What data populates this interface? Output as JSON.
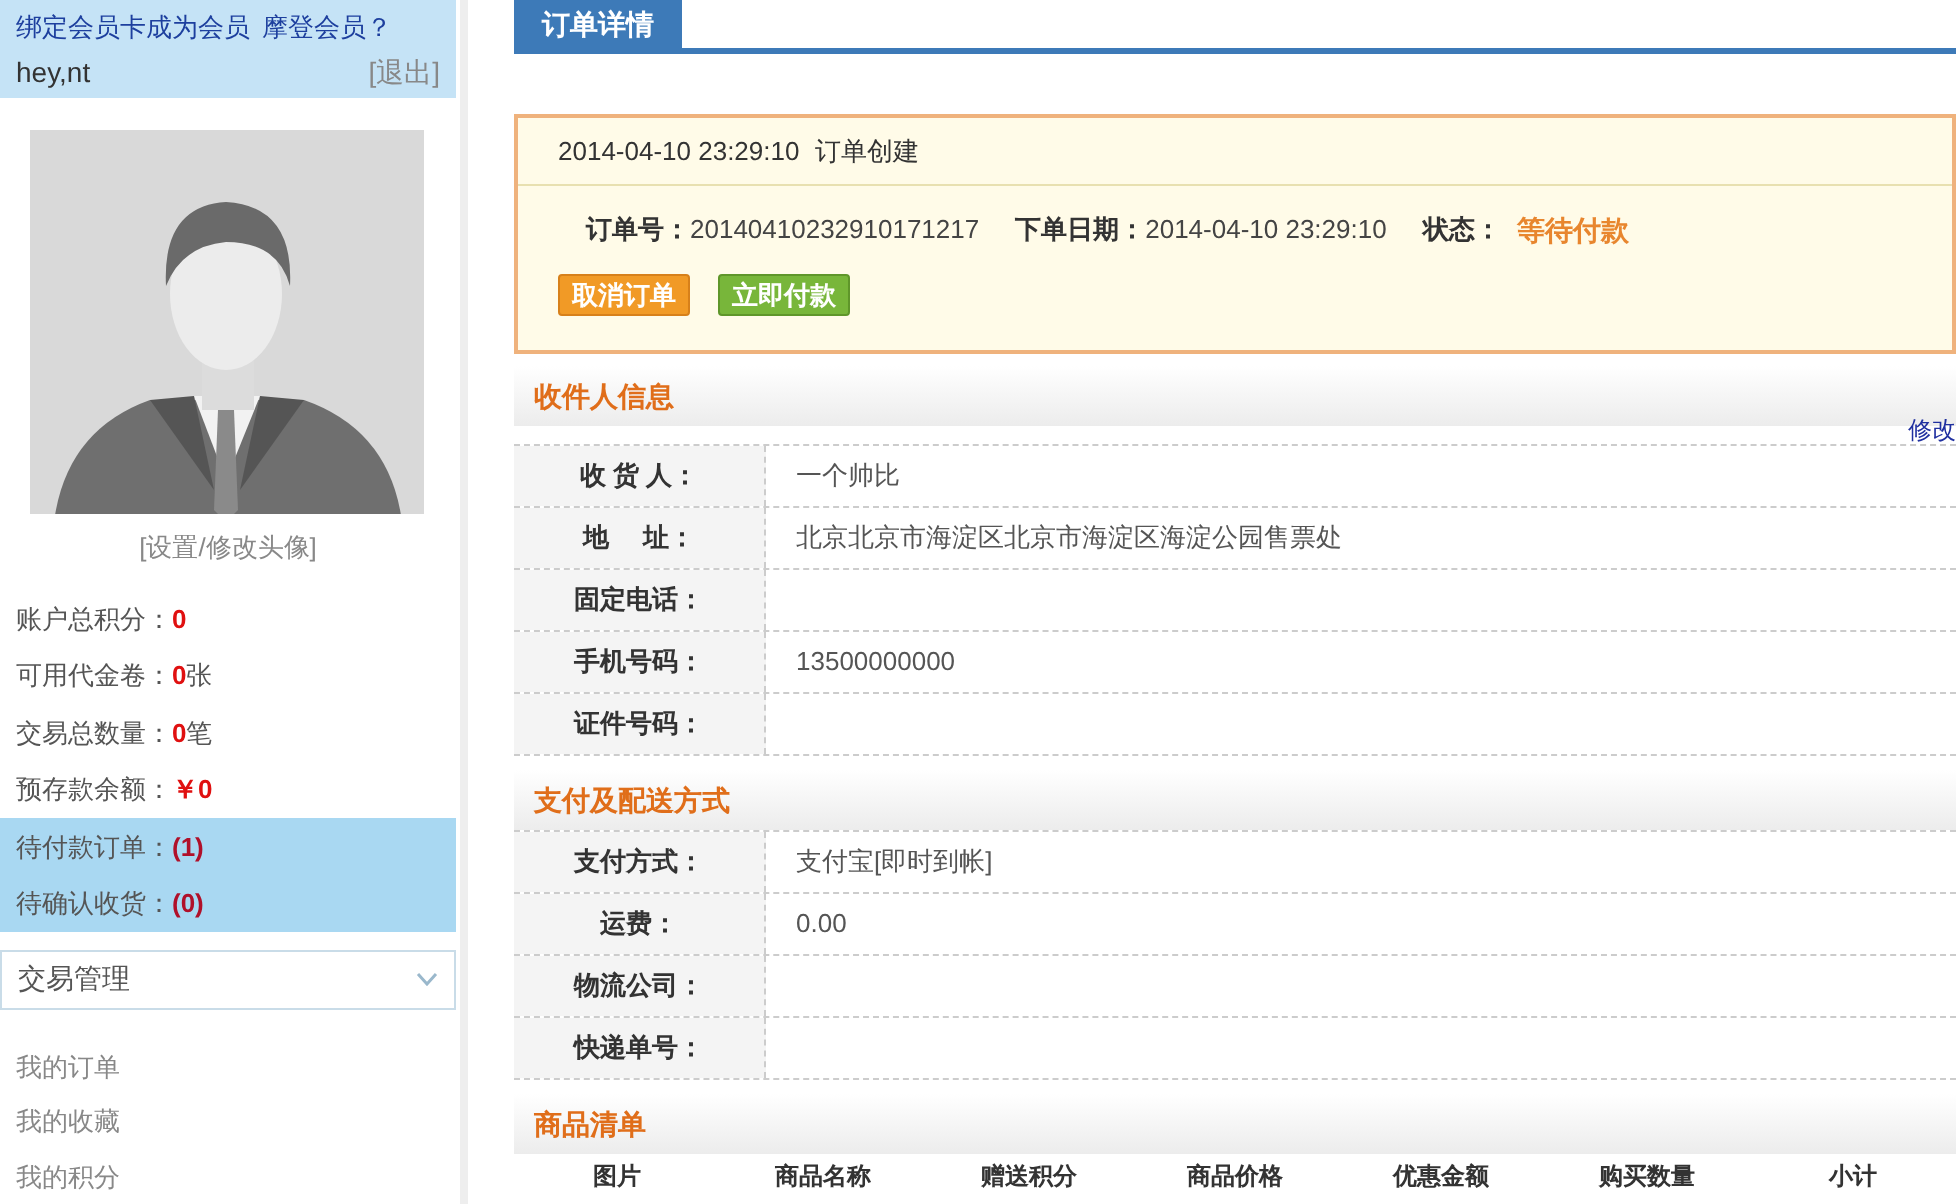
{
  "sidebar": {
    "member_links": [
      "绑定会员卡成为会员",
      "摩登会员？"
    ],
    "username": "hey,nt",
    "logout": "[退出]",
    "avatar_caption": "[设置/修改头像]",
    "stats": [
      {
        "label": "账户总积分：",
        "value": "0",
        "highlighted": false
      },
      {
        "label": "可用代金卷：",
        "value": "0",
        "unit": "张",
        "highlighted": false
      },
      {
        "label": "交易总数量：",
        "value": "0",
        "unit": "笔",
        "highlighted": false
      },
      {
        "label": "预存款余额：",
        "value": "￥0",
        "highlighted": false
      },
      {
        "label": "待付款订单：",
        "value": "(1)",
        "highlighted": true
      },
      {
        "label": "待确认收货：",
        "value": "(0)",
        "highlighted": true
      }
    ],
    "dropdown": {
      "label": "交易管理",
      "expanded": false
    },
    "menu": [
      "我的订单",
      "我的收藏",
      "我的积分"
    ]
  },
  "tabs": [
    {
      "label": "订单详情",
      "selected": true
    }
  ],
  "order": {
    "created_time": "2014-04-10 23:29:10",
    "created_text": "订单创建",
    "fields": [
      {
        "label": "订单号：",
        "value": "20140410232910171217"
      },
      {
        "label": "下单日期：",
        "value": "2014-04-10 23:29:10"
      },
      {
        "label": "状态：",
        "value": "等待付款"
      }
    ],
    "buttons": [
      {
        "label": "取消订单",
        "kind": "cancel"
      },
      {
        "label": "立即付款",
        "kind": "pay"
      }
    ]
  },
  "sections": [
    {
      "title": "收件人信息",
      "edit_link": "修改",
      "rows": [
        {
          "label": "收 货 人：",
          "value": "一个帅比"
        },
        {
          "label": "地　 址：",
          "value": "北京北京市海淀区北京市海淀区海淀公园售票处"
        },
        {
          "label": "固定电话："
        },
        {
          "label": "手机号码：",
          "value": "13500000000"
        },
        {
          "label": "证件号码："
        }
      ]
    },
    {
      "title": "支付及配送方式",
      "rows": [
        {
          "label": "支付方式：",
          "value": "支付宝[即时到帐]"
        },
        {
          "label": "运费：",
          "value": "0.00"
        },
        {
          "label": "物流公司："
        },
        {
          "label": "快递单号："
        }
      ]
    },
    {
      "title": "商品清单",
      "columns": [
        "图片",
        "商品名称",
        "赠送积分",
        "商品价格",
        "优惠金额",
        "购买数量",
        "小计"
      ]
    }
  ]
}
